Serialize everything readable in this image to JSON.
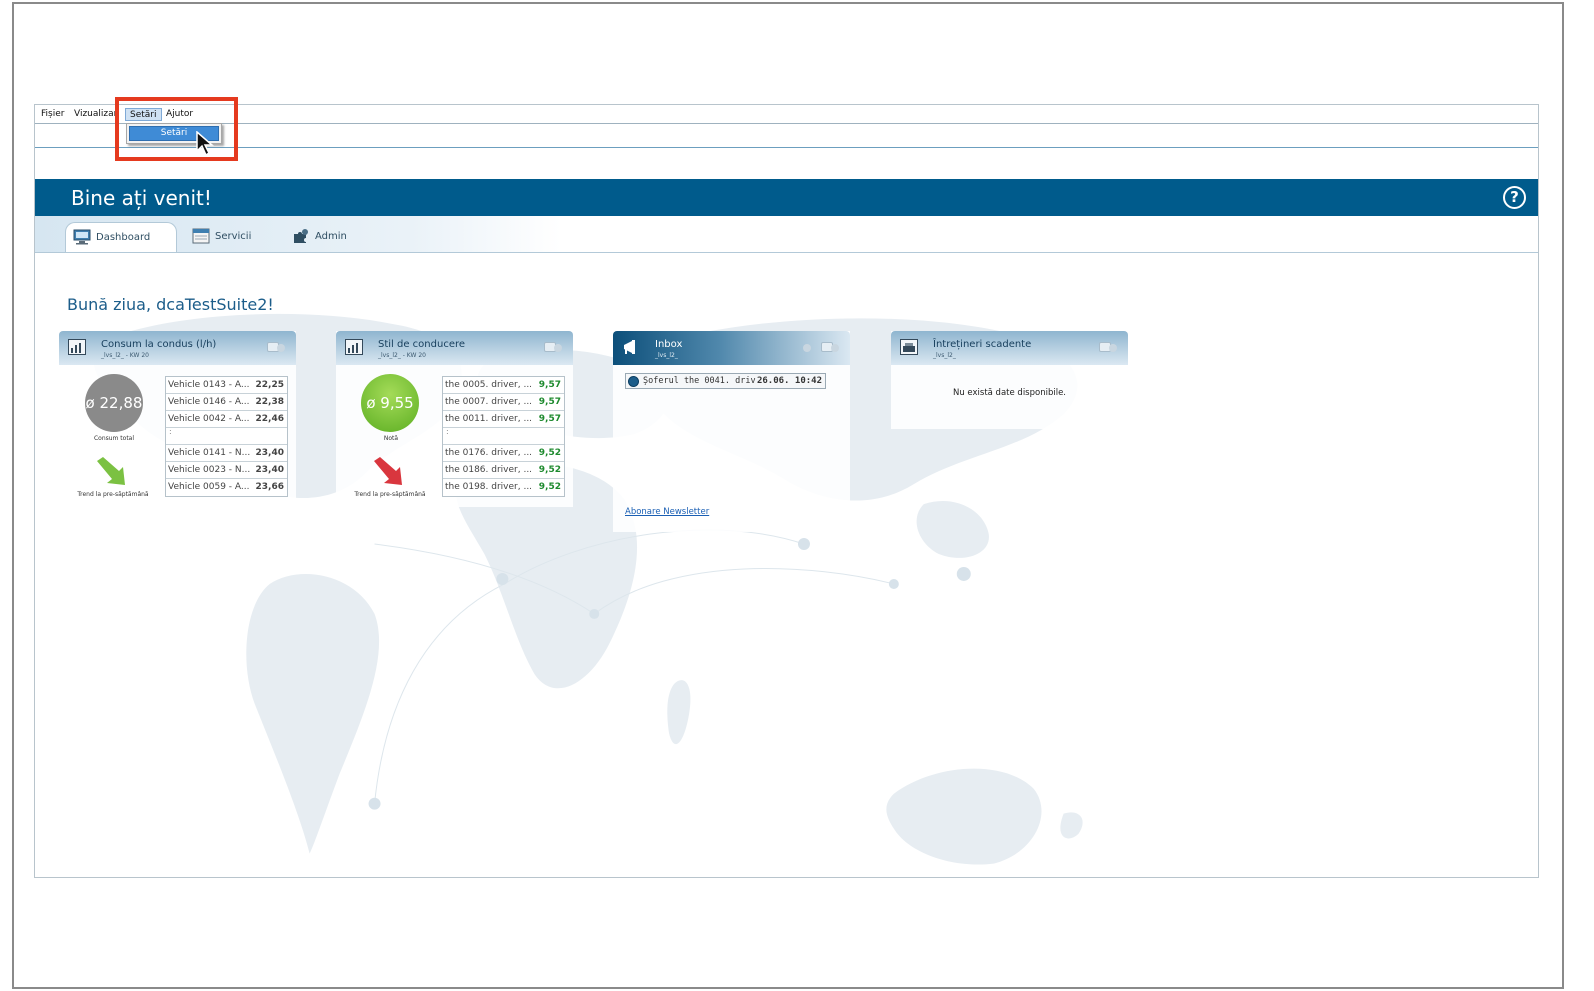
{
  "menubar": {
    "items": [
      "Fișier",
      "Vizualizar",
      "Setări",
      "Ajutor"
    ]
  },
  "dropdown": {
    "item": "Setări"
  },
  "banner": {
    "title": "Bine ați venit!",
    "help": "?"
  },
  "tabs": [
    {
      "label": "Dashboard",
      "icon": "monitor-icon"
    },
    {
      "label": "Servicii",
      "icon": "calendar-icon"
    },
    {
      "label": "Admin",
      "icon": "puzzle-icon"
    }
  ],
  "greeting": "Bună ziua, dcaTestSuite2!",
  "widgets": {
    "consum": {
      "title": "Consum la condus (l/h)",
      "subtitle": "_lvs_l2_ - KW 20",
      "kpi": "ø 22,88",
      "kpi_label": "Consum total",
      "trend_label": "Trend la pre-săptămână",
      "trend": "down",
      "top": [
        {
          "name": "Vehicle 0143 - A...",
          "value": "22,25"
        },
        {
          "name": "Vehicle 0146 - A...",
          "value": "22,38"
        },
        {
          "name": "Vehicle 0042 - A...",
          "value": "22,46"
        }
      ],
      "separator": ":",
      "bottom": [
        {
          "name": "Vehicle 0141 - N...",
          "value": "23,40"
        },
        {
          "name": "Vehicle 0023 - N...",
          "value": "23,40"
        },
        {
          "name": "Vehicle 0059 - A...",
          "value": "23,66"
        }
      ],
      "value_color": "#333333"
    },
    "stil": {
      "title": "Stil de conducere",
      "subtitle": "_lvs_l2_ - KW 20",
      "kpi": "ø 9,55",
      "kpi_label": "Notă",
      "trend_label": "Trend la pre-săptămână",
      "trend": "down-red",
      "top": [
        {
          "name": "the 0005. driver, ...",
          "value": "9,57"
        },
        {
          "name": "the 0007. driver, ...",
          "value": "9,57"
        },
        {
          "name": "the 0011. driver, ...",
          "value": "9,57"
        }
      ],
      "separator": ":",
      "bottom": [
        {
          "name": "the 0176. driver, ...",
          "value": "9,52"
        },
        {
          "name": "the 0186. driver, ...",
          "value": "9,52"
        },
        {
          "name": "the 0198. driver, ...",
          "value": "9,52"
        }
      ],
      "value_color": "#1e8a2e"
    },
    "inbox": {
      "title": "Inbox",
      "subtitle": "_lvs_l2_",
      "message": "Șoferul the 0041. driv...",
      "time": "26.06. 10:42",
      "newsletter": "Abonare Newsletter"
    },
    "intretineri": {
      "title": "Întrețineri scadente",
      "subtitle": "_lvs_l2_",
      "empty": "Nu există date disponibile."
    }
  },
  "colors": {
    "banner": "#005b8c",
    "highlight": "#e53a1f",
    "kpi_gray": "#8a8a8a",
    "kpi_green": "#6dbf2e",
    "arrow_green": "#7bc142",
    "arrow_red": "#d9363e"
  }
}
